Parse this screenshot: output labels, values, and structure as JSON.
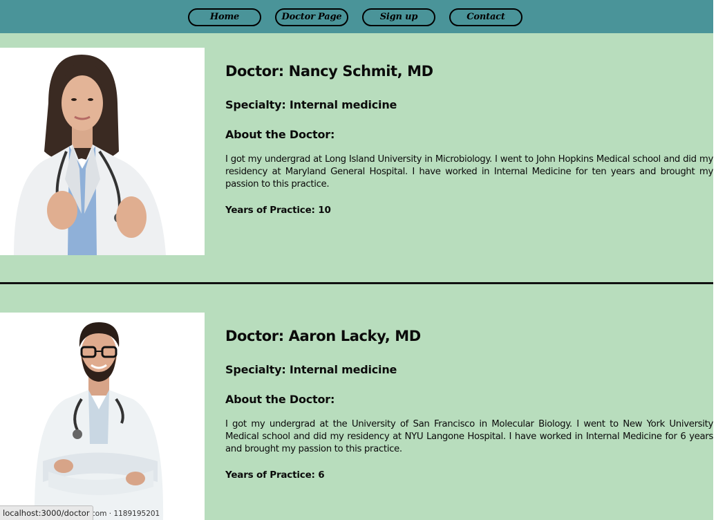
{
  "nav": {
    "home": "Home",
    "doctor_page": "Doctor Page",
    "sign_up": "Sign up",
    "contact": "Contact"
  },
  "doctors": [
    {
      "name": "Doctor: Nancy Schmit, MD",
      "specialty": "Specialty: Internal medicine",
      "about_heading": "About the Doctor:",
      "bio": "I got my undergrad at Long Island University in Microbiology. I went to John Hopkins Medical school and did my residency at Maryland General Hospital. I have worked in Internal Medicine for ten years and brought my passion to this practice.",
      "years": "Years of Practice: 10"
    },
    {
      "name": "Doctor: Aaron Lacky, MD",
      "specialty": "Specialty: Internal medicine",
      "about_heading": "About the Doctor:",
      "bio": "I got my undergrad at the University of San Francisco in Molecular Biology. I went to New York University Medical school and did my residency at NYU Langone Hospital. I have worked in Internal Medicine for 6 years and brought my passion to this practice.",
      "years": "Years of Practice: 6"
    }
  ],
  "image_watermark": "com · 1189195201",
  "status_url": "localhost:3000/doctor",
  "colors": {
    "page_bg": "#b8ddbd",
    "nav_bg": "#4a9499"
  }
}
